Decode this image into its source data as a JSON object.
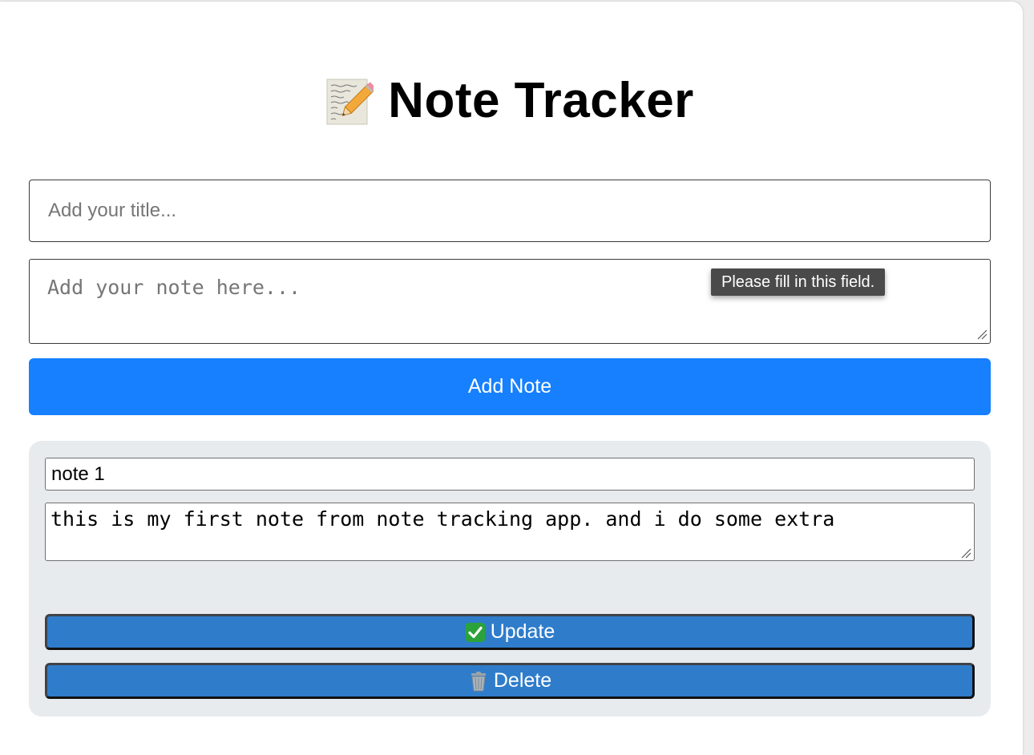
{
  "header": {
    "icon": "memo-pencil-icon",
    "title": "Note Tracker"
  },
  "form": {
    "title_placeholder": "Add your title...",
    "title_value": "",
    "note_placeholder": "Add your note here...",
    "note_value": "",
    "validation_tooltip": "Please fill in this field.",
    "add_button_label": "Add Note"
  },
  "notes": [
    {
      "title": "note 1",
      "body": "this is my first note from note tracking app. and i do some extra",
      "update_label": "Update",
      "update_icon": "check-mark-icon",
      "delete_label": "Delete",
      "delete_icon": "trash-can-icon"
    }
  ],
  "colors": {
    "primary": "#1680ff",
    "action_button": "#2f7ccb",
    "note_card_bg": "#e8ebee",
    "tooltip_bg": "#4a4a4a",
    "check_green": "#2ba33a"
  }
}
